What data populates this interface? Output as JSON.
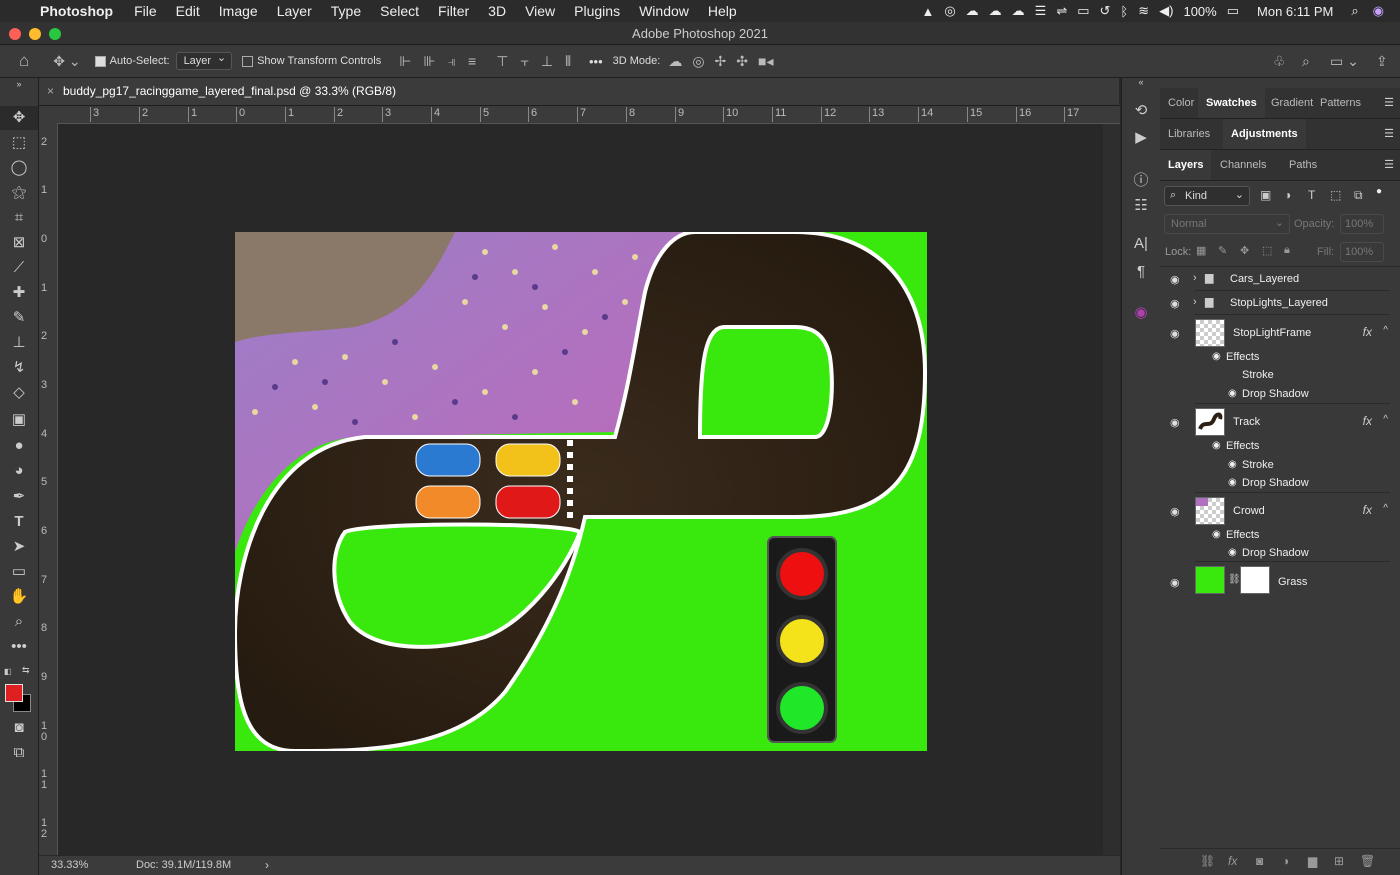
{
  "menubar": {
    "apple": "",
    "app": "Photoshop",
    "items": [
      "File",
      "Edit",
      "Image",
      "Layer",
      "Type",
      "Select",
      "Filter",
      "3D",
      "View",
      "Plugins",
      "Window",
      "Help"
    ],
    "battery": "100%",
    "clock": "Mon 6:11 PM"
  },
  "window": {
    "title": "Adobe Photoshop 2021"
  },
  "options": {
    "auto_select_label": "Auto-Select:",
    "auto_select_value": "Layer",
    "transform_label": "Show Transform Controls",
    "more": "•••",
    "mode_label": "3D Mode:"
  },
  "document": {
    "tab_title": "buddy_pg17_racinggame_layered_final.psd @ 33.3% (RGB/8)",
    "close": "×"
  },
  "rulers": {
    "h": [
      "3",
      "2",
      "1",
      "0",
      "1",
      "2",
      "3",
      "4",
      "5",
      "6",
      "7",
      "8",
      "9",
      "10",
      "11",
      "12",
      "13",
      "14",
      "15",
      "16",
      "17"
    ],
    "v": [
      "2",
      "1",
      "0",
      "1",
      "2",
      "3",
      "4",
      "5",
      "6",
      "7",
      "8",
      "9",
      "10",
      "11",
      "12"
    ]
  },
  "status": {
    "zoom": "33.33%",
    "doc": "Doc: 39.1M/119.8M",
    "arrow": "›"
  },
  "panels": {
    "row1": [
      "Color",
      "Swatches",
      "Gradient",
      "Patterns"
    ],
    "row2": [
      "Libraries",
      "Adjustments"
    ],
    "row3": [
      "Layers",
      "Channels",
      "Paths"
    ],
    "filter_kind": "Kind",
    "blend_mode": "Normal",
    "opacity_label": "Opacity:",
    "opacity": "100%",
    "lock_label": "Lock:",
    "fill_label": "Fill:",
    "fill": "100%"
  },
  "layers": [
    {
      "name": "Cars_Layered",
      "type": "group"
    },
    {
      "name": "StopLights_Layered",
      "type": "group"
    },
    {
      "name": "StopLightFrame",
      "type": "layer",
      "fx": true,
      "effects_label": "Effects",
      "effects": [
        "Stroke",
        "Drop Shadow"
      ]
    },
    {
      "name": "Track",
      "type": "layer",
      "fx": true,
      "effects_label": "Effects",
      "effects": [
        "Stroke",
        "Drop Shadow"
      ]
    },
    {
      "name": "Crowd",
      "type": "layer",
      "fx": true,
      "effects_label": "Effects",
      "effects": [
        "Drop Shadow"
      ]
    },
    {
      "name": "Grass",
      "type": "layer-mask"
    }
  ],
  "fx_label": "fx",
  "colors": {
    "grass": "#39e80d",
    "track": "#2c2015",
    "crowd": "#b070c0",
    "floor": "#8a7868",
    "foreground": "#e02020",
    "background": "#000000"
  }
}
